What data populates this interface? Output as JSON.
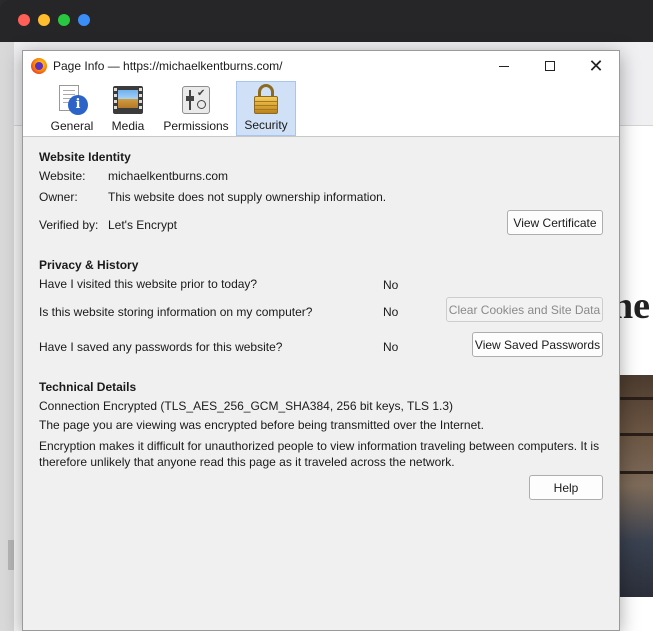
{
  "dialog": {
    "title": "Page Info — https://michaelkentburns.com/",
    "controls": {
      "minimize": "—",
      "maximize": "☐",
      "close": "✕"
    }
  },
  "tabs": [
    {
      "id": "general",
      "label": "General",
      "icon": "info-page-icon",
      "selected": false
    },
    {
      "id": "media",
      "label": "Media",
      "icon": "film-icon",
      "selected": false
    },
    {
      "id": "permissions",
      "label": "Permissions",
      "icon": "permissions-icon",
      "selected": false
    },
    {
      "id": "security",
      "label": "Security",
      "icon": "padlock-icon",
      "selected": true
    }
  ],
  "identity": {
    "heading": "Website Identity",
    "website_label": "Website:",
    "website_value": "michaelkentburns.com",
    "owner_label": "Owner:",
    "owner_value": "This website does not supply ownership information.",
    "verified_label": "Verified by:",
    "verified_value": "Let's Encrypt",
    "view_certificate": "View Certificate"
  },
  "privacy": {
    "heading": "Privacy & History",
    "q_visited": "Have I visited this website prior to today?",
    "a_visited": "No",
    "q_storing": "Is this website storing information on my computer?",
    "a_storing": "No",
    "clear_cookies": "Clear Cookies and Site Data",
    "q_passwords": "Have I saved any passwords for this website?",
    "a_passwords": "No",
    "view_passwords": "View Saved Passwords"
  },
  "technical": {
    "heading": "Technical Details",
    "connection": "Connection Encrypted (TLS_AES_256_GCM_SHA384, 256 bit keys, TLS 1.3)",
    "transmitted": "The page you are viewing was encrypted before being transmitted over the Internet.",
    "explanation": "Encryption makes it difficult for unauthorized people to view information traveling between computers. It is therefore unlikely that anyone read this page as it traveled across the network.",
    "help": "Help"
  },
  "background": {
    "heading_fragment": "ne"
  },
  "colors": {
    "selected_tab": "#cfe0f7",
    "dialog_bg": "#f0f0f0",
    "disabled_text": "#8a8a8a"
  }
}
